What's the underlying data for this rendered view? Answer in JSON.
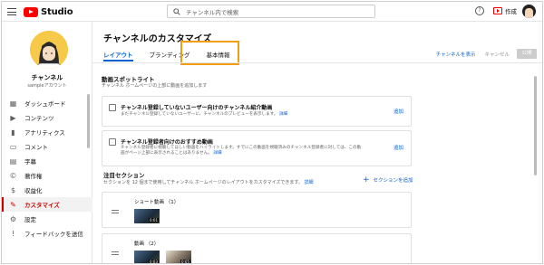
{
  "app": {
    "logo_text": "Studio",
    "brand_color": "#ff0000",
    "accent_color": "#065fd4",
    "highlight_color": "#f29d13"
  },
  "topbar": {
    "search_placeholder": "チャンネル内で検索",
    "create_label": "作成",
    "help_label": "?"
  },
  "sidebar": {
    "channel_name": "チャンネル",
    "channel_sub": "sampleアカウント",
    "items": [
      {
        "label": "ダッシュボード",
        "icon": "dashboard-icon",
        "glyph": "▦"
      },
      {
        "label": "コンテンツ",
        "icon": "content-icon",
        "glyph": "▶"
      },
      {
        "label": "アナリティクス",
        "icon": "analytics-icon",
        "glyph": "▮"
      },
      {
        "label": "コメント",
        "icon": "comment-icon",
        "glyph": "▭"
      },
      {
        "label": "字幕",
        "icon": "subtitles-icon",
        "glyph": "▤"
      },
      {
        "label": "著作権",
        "icon": "copyright-icon",
        "glyph": "©"
      },
      {
        "label": "収益化",
        "icon": "monetization-icon",
        "glyph": "$"
      },
      {
        "label": "カスタマイズ",
        "icon": "customize-icon",
        "glyph": "✎"
      },
      {
        "label": "設定",
        "icon": "settings-icon",
        "glyph": "⚙"
      },
      {
        "label": "フィードバックを送信",
        "icon": "feedback-icon",
        "glyph": "!"
      }
    ],
    "active_index": 7
  },
  "main": {
    "title": "チャンネルのカスタマイズ",
    "tabs": [
      {
        "label": "レイアウト",
        "active": true
      },
      {
        "label": "ブランディング",
        "active": false
      },
      {
        "label": "基本情報",
        "active": false
      }
    ],
    "actions": {
      "view_channel": "チャンネルを表示",
      "cancel": "キャンセル",
      "publish": "公開"
    },
    "spotlight": {
      "title": "動画スポットライト",
      "desc": "チャンネル ホームページの上部に動画を追加します",
      "cards": [
        {
          "title": "チャンネル登録していないユーザー向けのチャンネル紹介動画",
          "desc": "まだチャンネル登録していないユーザーに、チャンネルのプレビューを表示します。",
          "link": "詳細",
          "add": "追加"
        },
        {
          "title": "チャンネル登録者向けのおすすめ動画",
          "desc1": "チャンネル登録者に視聴してほしい動画をハイライトします。すでにこの動画を視聴済みのチャンネル登録者に対しては、この動",
          "desc2": "画がページ上部に表示されることはありません。",
          "link": "詳細",
          "add": "追加"
        }
      ]
    },
    "featured": {
      "title": "注目セクション",
      "desc": "セクションを 12 個まで使用してチャンネル ホームページのレイアウトをカスタマイズできます。",
      "link": "詳細",
      "add_section": "セクションを追加",
      "shelves": [
        {
          "label": "ショート動画 （1）",
          "thumbs": [
            "0:01"
          ]
        },
        {
          "label": "動画 （2）",
          "thumbs": [
            "0:03",
            "0:05"
          ]
        }
      ]
    }
  }
}
